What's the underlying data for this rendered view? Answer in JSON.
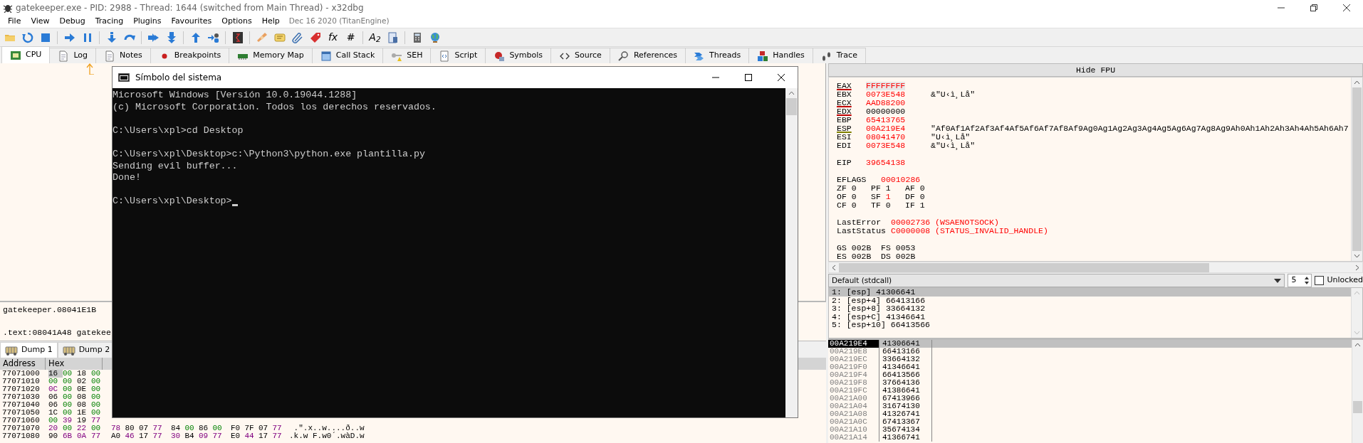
{
  "window": {
    "title": "gatekeeper.exe - PID: 2988 - Thread: 1644 (switched from Main Thread) - x32dbg"
  },
  "menu": [
    "File",
    "View",
    "Debug",
    "Tracing",
    "Plugins",
    "Favourites",
    "Options",
    "Help"
  ],
  "build_info": "Dec 16 2020 (TitanEngine)",
  "toolbar": [
    {
      "kind": "folder"
    },
    {
      "kind": "restart"
    },
    {
      "kind": "stop"
    },
    {
      "kind": "separator"
    },
    {
      "kind": "run"
    },
    {
      "kind": "pause"
    },
    {
      "kind": "separator"
    },
    {
      "kind": "step-into"
    },
    {
      "kind": "step-over"
    },
    {
      "kind": "separator"
    },
    {
      "kind": "trace-into"
    },
    {
      "kind": "trace-over"
    },
    {
      "kind": "separator"
    },
    {
      "kind": "step-out"
    },
    {
      "kind": "run-user"
    },
    {
      "kind": "separator"
    },
    {
      "kind": "scylla"
    },
    {
      "kind": "separator"
    },
    {
      "kind": "patch"
    },
    {
      "kind": "comment"
    },
    {
      "kind": "label"
    },
    {
      "kind": "bookmark"
    },
    {
      "kind": "text",
      "label": "fx"
    },
    {
      "kind": "text",
      "label": "#"
    },
    {
      "kind": "separator"
    },
    {
      "kind": "text",
      "label": "A$_{2}$"
    },
    {
      "kind": "strings"
    },
    {
      "kind": "separator"
    },
    {
      "kind": "calculator"
    },
    {
      "kind": "globe"
    }
  ],
  "tabs": [
    {
      "label": "CPU",
      "kind": "chip",
      "selected": true
    },
    {
      "label": "Log",
      "kind": "page",
      "selected": false
    },
    {
      "label": "Notes",
      "kind": "page",
      "selected": false
    },
    {
      "label": "Breakpoints",
      "kind": "dot",
      "selected": false
    },
    {
      "label": "Memory Map",
      "kind": "memory",
      "selected": false
    },
    {
      "label": "Call Stack",
      "kind": "window",
      "selected": false
    },
    {
      "label": "SEH",
      "kind": "key",
      "selected": false
    },
    {
      "label": "Script",
      "kind": "script",
      "selected": false
    },
    {
      "label": "Symbols",
      "kind": "ball",
      "selected": false
    },
    {
      "label": "Source",
      "kind": "code",
      "selected": false
    },
    {
      "label": "References",
      "kind": "magnifier",
      "selected": false
    },
    {
      "label": "Threads",
      "kind": "arrows",
      "selected": false
    },
    {
      "label": "Handles",
      "kind": "blocks",
      "selected": false
    },
    {
      "label": "Trace",
      "kind": "footprints",
      "selected": false
    }
  ],
  "info": {
    "lines": [
      "gatekeeper.08041E1B",
      ".text:08041A48 gatekee"
    ]
  },
  "dump": {
    "tabs": [
      {
        "label": "Dump 1",
        "selected": true
      },
      {
        "label": "Dump 2",
        "selected": false
      }
    ],
    "columns": [
      "Address",
      "Hex"
    ],
    "rows": [
      {
        "address": "77071000",
        "groups": [
          [
            "16",
            "00",
            "18",
            "00"
          ]
        ],
        "first_byte_selected": true
      },
      {
        "address": "77071010",
        "groups": [
          [
            "00",
            "00",
            "02",
            "00"
          ]
        ],
        "first_byte_selected": false
      },
      {
        "address": "77071020",
        "groups": [
          [
            "0C",
            "00",
            "0E",
            "00"
          ]
        ],
        "first_byte_selected": false
      },
      {
        "address": "77071030",
        "groups": [
          [
            "06",
            "00",
            "08",
            "00"
          ]
        ],
        "first_byte_selected": false
      },
      {
        "address": "77071040",
        "groups": [
          [
            "06",
            "00",
            "08",
            "00"
          ]
        ],
        "first_byte_selected": false
      },
      {
        "address": "77071050",
        "groups": [
          [
            "1C",
            "00",
            "1E",
            "00"
          ]
        ],
        "first_byte_selected": false
      },
      {
        "address": "77071060",
        "groups": [
          [
            "00",
            "39",
            "19",
            "77"
          ]
        ],
        "first_byte_selected": false
      },
      {
        "address": "77071070",
        "first_byte_selected": false,
        "groups": [
          [
            "20",
            "00",
            "22",
            "00"
          ],
          [
            "78",
            "80",
            "07",
            "77"
          ],
          [
            "84",
            "00",
            "86",
            "00"
          ],
          [
            "F0",
            "7F",
            "07",
            "77"
          ]
        ],
        "ascii": " .\".x..w....ð..w"
      },
      {
        "address": "77071080",
        "first_byte_selected": false,
        "groups": [
          [
            "90",
            "6B",
            "0A",
            "77"
          ],
          [
            "A0",
            "46",
            "17",
            "77"
          ],
          [
            "30",
            "B4",
            "09",
            "77"
          ],
          [
            "E0",
            "44",
            "17",
            "77"
          ]
        ],
        "ascii": ".k.w F.w0´.wàD.w"
      }
    ]
  },
  "fpu_toggle": "Hide FPU",
  "registers": [
    {
      "name": "EAX",
      "value": "FFFFFFFF",
      "changed": true,
      "selected": true,
      "color": "#c00000"
    },
    {
      "name": "EBX",
      "value": "0073E548",
      "changed": true,
      "selected": false,
      "comment": "&\"U‹ì¸Lå\""
    },
    {
      "name": "ECX",
      "value": "AAD88200",
      "changed": true,
      "selected": false,
      "color": "#c00000"
    },
    {
      "name": "EDX",
      "value": "00000000",
      "changed": false,
      "selected": false,
      "color": "#c00000"
    },
    {
      "name": "EBP",
      "value": "65413765",
      "changed": true,
      "selected": false
    },
    {
      "name": "ESP",
      "value": "00A219E4",
      "changed": true,
      "selected": false,
      "color": "#808000",
      "comment": "\"Af0Af1Af2Af3Af4Af5Af6Af7Af8Af9Ag0Ag1Ag2Ag3Ag4Ag5Ag6Ag7Ag8Ag9Ah0Ah1Ah2Ah3Ah4Ah5Ah6Ah7"
    },
    {
      "name": "ESI",
      "value": "08041470",
      "changed": true,
      "selected": false,
      "comment": "\"U‹ì¸Lå\""
    },
    {
      "name": "EDI",
      "value": "0073E548",
      "changed": true,
      "selected": false,
      "comment": "&\"U‹ì¸Lå\""
    }
  ],
  "eip": {
    "name": "EIP",
    "value": "39654138",
    "changed": true
  },
  "eflags": {
    "name": "EFLAGS",
    "value": "00010286",
    "changed": true
  },
  "flags": [
    [
      {
        "name": "ZF",
        "value": "0",
        "changed": false
      },
      {
        "name": "PF",
        "value": "1",
        "changed": false
      },
      {
        "name": "AF",
        "value": "0",
        "changed": false
      }
    ],
    [
      {
        "name": "OF",
        "value": "0",
        "changed": false
      },
      {
        "name": "SF",
        "value": "1",
        "changed": true
      },
      {
        "name": "DF",
        "value": "0",
        "changed": false
      }
    ],
    [
      {
        "name": "CF",
        "value": "0",
        "changed": false
      },
      {
        "name": "TF",
        "value": "0",
        "changed": false
      },
      {
        "name": "IF",
        "value": "1",
        "changed": false
      }
    ]
  ],
  "errors": [
    {
      "name": "LastError",
      "value": "00002736 (WSAENOTSOCK)",
      "changed": true
    },
    {
      "name": "LastStatus",
      "value": "C0000008 (STATUS_INVALID_HANDLE)",
      "changed": true
    }
  ],
  "segments": [
    [
      {
        "name": "GS",
        "value": "002B"
      },
      {
        "name": "FS",
        "value": "0053"
      }
    ],
    [
      {
        "name": "ES",
        "value": "002B"
      },
      {
        "name": "DS",
        "value": "002B"
      }
    ]
  ],
  "call_convention": {
    "value": "Default (stdcall)",
    "arg_count": "5",
    "unlocked_label": "Unlocked",
    "unlocked": false
  },
  "arguments": [
    {
      "text": "1: [esp] 41306641",
      "selected": true
    },
    {
      "text": "2: [esp+4] 66413166",
      "selected": false
    },
    {
      "text": "3: [esp+8] 33664132",
      "selected": false
    },
    {
      "text": "4: [esp+C] 41346641",
      "selected": false
    },
    {
      "text": "5: [esp+10] 66413566",
      "selected": false
    }
  ],
  "stack": [
    {
      "address": "00A219E4",
      "value": "41306641",
      "selected": true
    },
    {
      "address": "00A219E8",
      "value": "66413166",
      "selected": false
    },
    {
      "address": "00A219EC",
      "value": "33664132",
      "selected": false
    },
    {
      "address": "00A219F0",
      "value": "41346641",
      "selected": false
    },
    {
      "address": "00A219F4",
      "value": "66413566",
      "selected": false
    },
    {
      "address": "00A219F8",
      "value": "37664136",
      "selected": false
    },
    {
      "address": "00A219FC",
      "value": "41386641",
      "selected": false
    },
    {
      "address": "00A21A00",
      "value": "67413966",
      "selected": false
    },
    {
      "address": "00A21A04",
      "value": "31674130",
      "selected": false
    },
    {
      "address": "00A21A08",
      "value": "41326741",
      "selected": false
    },
    {
      "address": "00A21A0C",
      "value": "67413367",
      "selected": false
    },
    {
      "address": "00A21A10",
      "value": "35674134",
      "selected": false
    },
    {
      "address": "00A21A14",
      "value": "41366741",
      "selected": false
    }
  ],
  "console": {
    "title": "Símbolo del sistema",
    "paragraphs": [
      [
        "Microsoft Windows [Versión 10.0.19044.1288]",
        "(c) Microsoft Corporation. Todos los derechos reservados."
      ],
      [
        "C:\\Users\\xpl>cd Desktop"
      ],
      [
        "C:\\Users\\xpl\\Desktop>c:\\Python3\\python.exe plantilla.py",
        "Sending evil buffer...",
        "Done!"
      ],
      [
        "C:\\Users\\xpl\\Desktop>"
      ]
    ],
    "cursor": true
  }
}
